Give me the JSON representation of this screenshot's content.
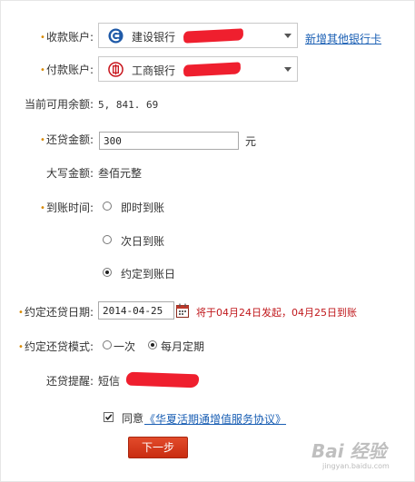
{
  "collect_account": {
    "label": "收款账户:",
    "bank_name": "建设银行",
    "link": "新增其他银行卡"
  },
  "pay_account": {
    "label": "付款账户:",
    "bank_name": "工商银行"
  },
  "balance": {
    "label": "当前可用余额:",
    "value": "5, 841. 69"
  },
  "repay_amount": {
    "label": "还贷金额:",
    "value": "300",
    "unit": "元"
  },
  "amount_words": {
    "label": "大写金额:",
    "value": "叁佰元整"
  },
  "arrival_time": {
    "label": "到账时间:",
    "options": [
      "即时到账",
      "次日到账",
      "约定到账日"
    ],
    "selected": "约定到账日"
  },
  "appointed_date": {
    "label": "约定还贷日期:",
    "value": "2014-04-25",
    "note": "将于04月24日发起，04月25日到账"
  },
  "appointed_mode": {
    "label": "约定还贷模式:",
    "options": [
      "一次",
      "每月定期"
    ],
    "selected": "每月定期"
  },
  "reminder": {
    "label": "还贷提醒:",
    "value": "短信"
  },
  "agreement": {
    "prefix": "同意",
    "link": "《华夏活期通增值服务协议》",
    "checked": true
  },
  "next_button": "下一步",
  "watermark": {
    "main": "Bai 经验",
    "sub": "jingyan.baidu.com"
  },
  "colors": {
    "link": "#1a5fb4",
    "button": "#d23a1c",
    "note": "#c0181c",
    "redaction": "#ef1f2e"
  }
}
